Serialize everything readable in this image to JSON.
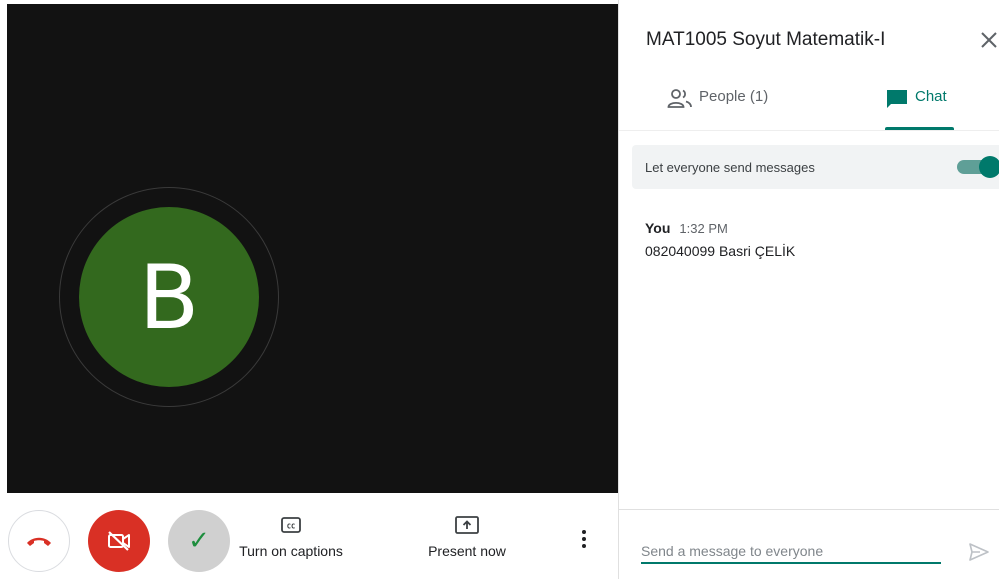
{
  "stage": {
    "avatar_letter": "B",
    "avatar_color": "#33691e"
  },
  "controls": {
    "hangup_icon": "phone-hangup-icon",
    "camera_icon": "camera-off-icon",
    "camera_color": "#d93025",
    "check_icon": "check-icon",
    "captions_label": "Turn on captions",
    "captions_icon": "closed-captions-icon",
    "present_label": "Present now",
    "present_icon": "present-screen-icon",
    "more_icon": "more-vertical-icon"
  },
  "panel": {
    "title": "MAT1005 Soyut Matematik-I",
    "close_icon": "close-icon",
    "tabs": [
      {
        "label": "People (1)",
        "icon": "people-icon",
        "active": false
      },
      {
        "label": "Chat",
        "icon": "chat-icon",
        "active": true
      }
    ],
    "accent_color": "#00796b",
    "toggle": {
      "label": "Let everyone send messages",
      "enabled": true
    },
    "messages": [
      {
        "sender": "You",
        "time": "1:32 PM",
        "text": "082040099 Basri ÇELİK"
      }
    ],
    "compose": {
      "placeholder": "Send a message to everyone",
      "value": "",
      "send_icon": "send-icon"
    }
  }
}
